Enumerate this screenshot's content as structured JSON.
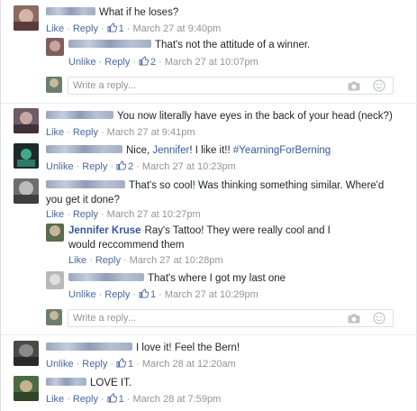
{
  "thread": {
    "reply_placeholder": "Write a reply...",
    "comments": [
      {
        "text": "What if he loses?",
        "actions": {
          "primary": "Like",
          "reply": "Reply",
          "likes": "1",
          "time": "March 27 at 9:40pm"
        }
      },
      {
        "text": "That's not the attitude of a winner.",
        "actions": {
          "primary": "Unlike",
          "reply": "Reply",
          "likes": "2",
          "time": "March 27 at 10:07pm"
        }
      },
      {
        "text": "You now literally have eyes in the back of your head (neck?)",
        "actions": {
          "primary": "Like",
          "reply": "Reply",
          "time": "March 27 at 9:41pm"
        }
      },
      {
        "text_pre": "Nice, ",
        "mention": "Jennifer",
        "text_mid": "! I like it!! ",
        "hashtag": "#YearningForBerning",
        "actions": {
          "primary": "Unlike",
          "reply": "Reply",
          "likes": "2",
          "time": "March 27 at 10:23pm"
        }
      },
      {
        "text": "That's so cool! Was thinking something similar. Where'd you get it done?",
        "actions": {
          "primary": "Like",
          "reply": "Reply",
          "time": "March 27 at 10:27pm"
        }
      },
      {
        "name": "Jennifer Kruse",
        "text": "Ray's Tattoo! They were really cool and I would reccommend them",
        "actions": {
          "primary": "Like",
          "reply": "Reply",
          "time": "March 27 at 10:28pm"
        }
      },
      {
        "text": "That's where I got my last one",
        "actions": {
          "primary": "Unlike",
          "reply": "Reply",
          "likes": "1",
          "time": "March 27 at 10:29pm"
        }
      },
      {
        "text": "I love it! Feel the Bern!",
        "actions": {
          "primary": "Unlike",
          "reply": "Reply",
          "likes": "1",
          "time": "March 28 at 12:20am"
        }
      },
      {
        "text": "LOVE IT.",
        "actions": {
          "primary": "Like",
          "reply": "Reply",
          "likes": "1",
          "time": "March 28 at 7:59pm"
        }
      }
    ]
  },
  "colors": {
    "link": "#4b67a1",
    "name": "#365899",
    "meta": "#90949c",
    "text": "#1d2129"
  },
  "icons": {
    "like": "thumbs-up-icon",
    "camera": "camera-icon",
    "emoji": "smiley-icon"
  }
}
